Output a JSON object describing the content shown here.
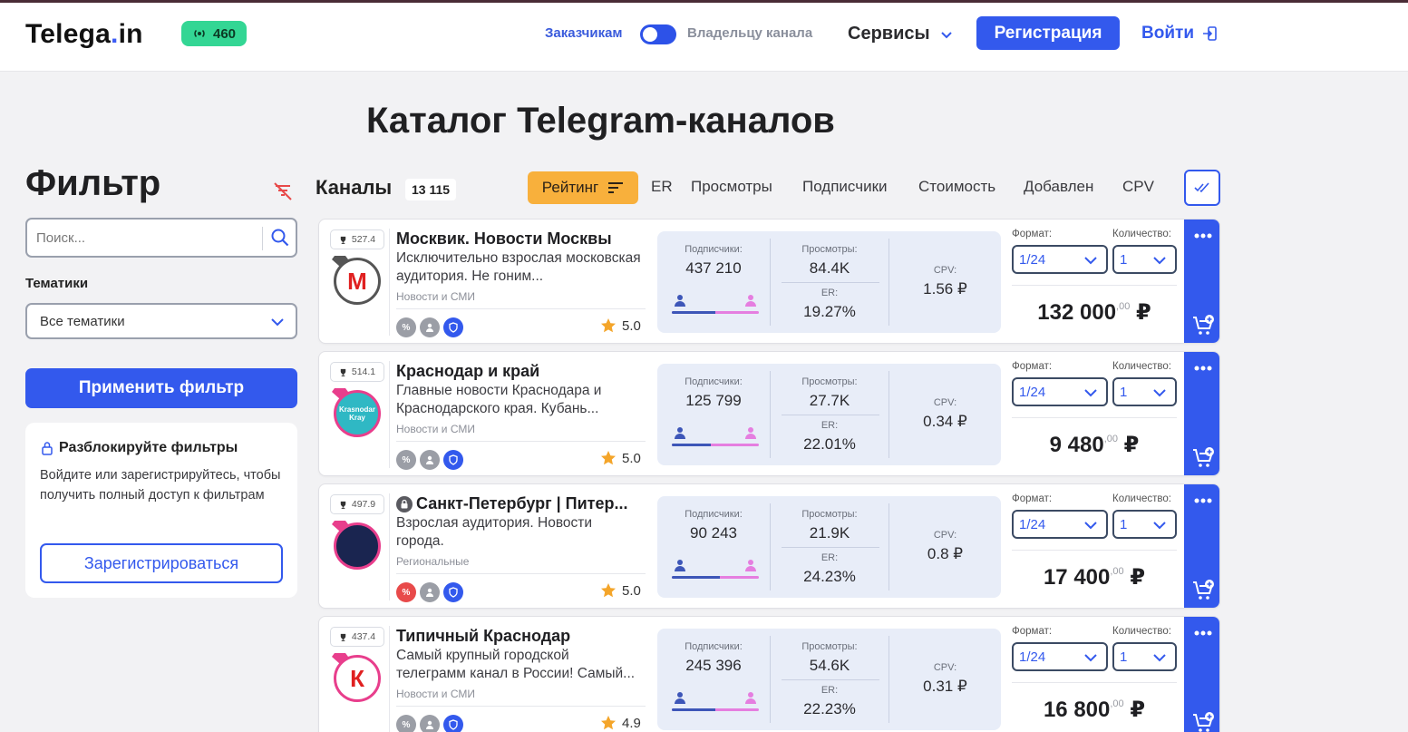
{
  "header": {
    "logo_main": "Telega",
    "logo_dot": ".",
    "logo_tld": "in",
    "online_count": "460",
    "role_customers": "Заказчикам",
    "role_owner": "Владельцу канала",
    "services": "Сервисы",
    "register": "Регистрация",
    "login": "Войти"
  },
  "page": {
    "title": "Каталог Telegram-каналов"
  },
  "sidebar": {
    "filter_title": "Фильтр",
    "search_placeholder": "Поиск...",
    "topics_label": "Тематики",
    "topics_value": "Все тематики",
    "apply": "Применить фильтр",
    "unlock_title": "Разблокируйте фильтры",
    "unlock_text": "Войдите или зарегистрируйтесь, чтобы получить полный доступ к фильтрам",
    "unlock_button": "Зарегистрироваться"
  },
  "channels_header": {
    "label": "Каналы",
    "count": "13 115",
    "sort_active": "Рейтинг",
    "sort_options": [
      "ER",
      "Просмотры",
      "Подписчики",
      "Стоимость",
      "Добавлен",
      "CPV"
    ]
  },
  "labels": {
    "subscribers": "Подписчики:",
    "views": "Просмотры:",
    "er": "ER:",
    "cpv": "CPV:",
    "format": "Формат:",
    "quantity": "Количество:",
    "percent_badge": "%"
  },
  "channels": [
    {
      "rating": "527.4",
      "name": "Москвик. Новости Москвы",
      "locked": false,
      "description": "Исключительно взрослая московская аудитория. Не гоним...",
      "category": "Новости и СМИ",
      "score": "5.0",
      "subscribers": "437 210",
      "views": "84.4K",
      "er": "19.27%",
      "cpv": "1.56 ₽",
      "male_share": 0.5,
      "format": "1/24",
      "quantity": "1",
      "price": "132 000",
      "price_cents": ",00",
      "currency": "₽",
      "discount_active": false,
      "avatar_color": "#ffffff",
      "avatar_text": "М",
      "avatar_text_color": "#e02020",
      "avatar_border": "#555555",
      "diamond": "#555555"
    },
    {
      "rating": "514.1",
      "name": "Краснодар и край",
      "locked": false,
      "description": "Главные новости Краснодара и Краснодарского края. Кубань...",
      "category": "Новости и СМИ",
      "score": "5.0",
      "subscribers": "125 799",
      "views": "27.7K",
      "er": "22.01%",
      "cpv": "0.34 ₽",
      "male_share": 0.45,
      "format": "1/24",
      "quantity": "1",
      "price": "9 480",
      "price_cents": ",00",
      "currency": "₽",
      "discount_active": false,
      "avatar_color": "#2fb8c4",
      "avatar_text": "Krasnodar Kray",
      "avatar_text_color": "#ffffff",
      "avatar_border": "#e83e8c",
      "diamond": "#e83e8c"
    },
    {
      "rating": "497.9",
      "name": "Санкт-Петербург | Питер...",
      "locked": true,
      "description": "Взрослая аудитория. Новости города.",
      "category": "Региональные",
      "score": "5.0",
      "subscribers": "90 243",
      "views": "21.9K",
      "er": "24.23%",
      "cpv": "0.8 ₽",
      "male_share": 0.55,
      "format": "1/24",
      "quantity": "1",
      "price": "17 400",
      "price_cents": ",00",
      "currency": "₽",
      "discount_active": true,
      "avatar_color": "#1a2550",
      "avatar_text": "",
      "avatar_text_color": "#ffffff",
      "avatar_border": "#e83e8c",
      "diamond": "#e83e8c"
    },
    {
      "rating": "437.4",
      "name": "Типичный Краснодар",
      "locked": false,
      "description": "Самый крупный городской телеграмм канал в России! Самый...",
      "category": "Новости и СМИ",
      "score": "4.9",
      "subscribers": "245 396",
      "views": "54.6K",
      "er": "22.23%",
      "cpv": "0.31 ₽",
      "male_share": 0.5,
      "format": "1/24",
      "quantity": "1",
      "price": "16 800",
      "price_cents": ",00",
      "currency": "₽",
      "discount_active": false,
      "avatar_color": "#ffffff",
      "avatar_text": "К",
      "avatar_text_color": "#e02020",
      "avatar_border": "#e83e8c",
      "diamond": "#e83e8c"
    }
  ]
}
